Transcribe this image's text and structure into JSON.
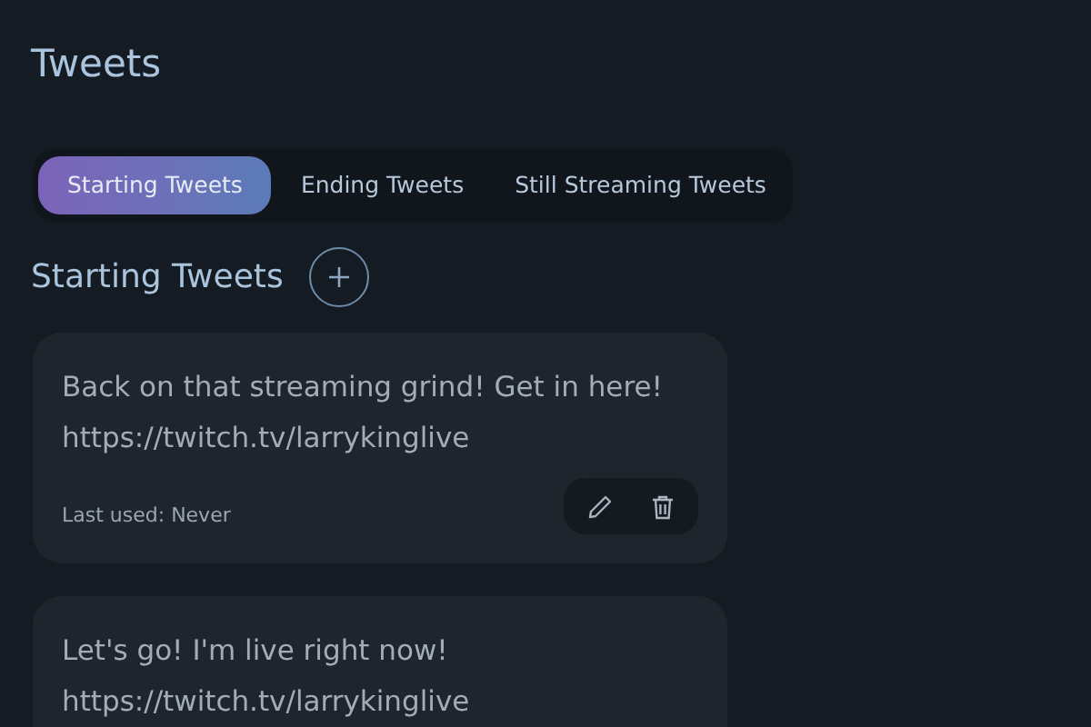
{
  "title": "Tweets",
  "tabs": [
    {
      "label": "Starting Tweets",
      "selected": true
    },
    {
      "label": "Ending Tweets",
      "selected": false
    },
    {
      "label": "Still Streaming Tweets",
      "selected": false
    }
  ],
  "section": {
    "title": "Starting Tweets"
  },
  "tweets": [
    {
      "text": "Back on that streaming grind! Get in here!\nhttps://twitch.tv/larrykinglive",
      "last_used": "Last used: Never"
    },
    {
      "text": "Let's go! I'm live right now!\nhttps://twitch.tv/larrykinglive"
    }
  ]
}
